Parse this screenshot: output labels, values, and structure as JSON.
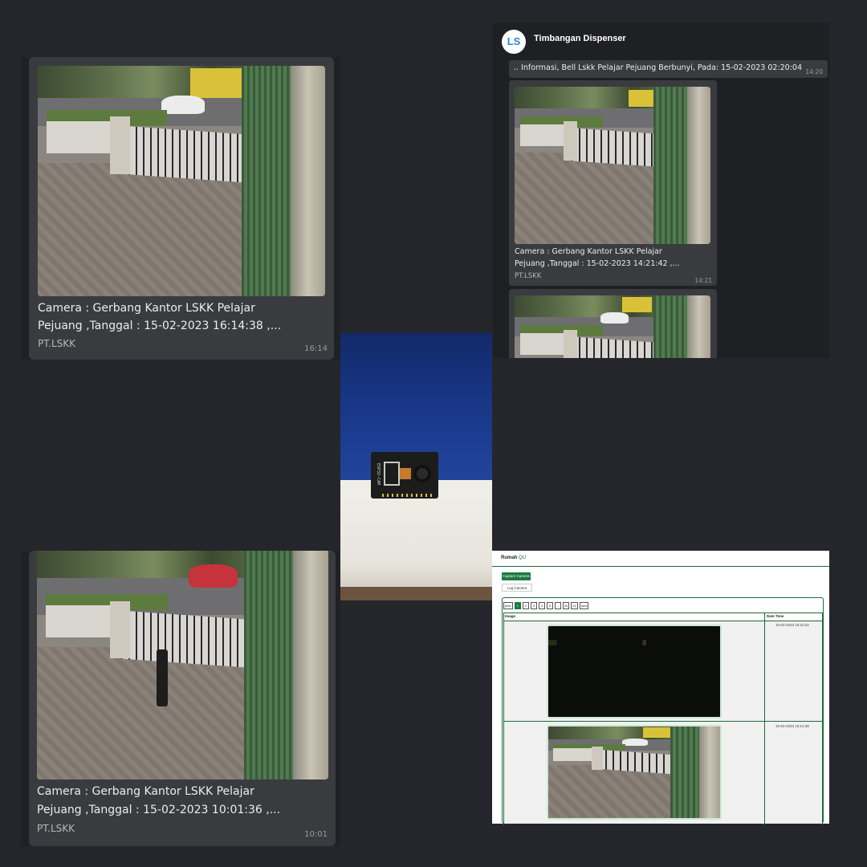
{
  "chat_top_left": {
    "caption_line1": "Camera : Gerbang Kantor LSKK Pelajar",
    "caption_line2": "Pejuang ,Tanggal : 15-02-2023 16:14:38  ,...",
    "sender": "PT.LSKK",
    "time": "16:14"
  },
  "chat_top_right": {
    "avatar_text": "LS",
    "title": "Timbangan Dispenser",
    "info_message": ".. Informasi, Bell Lskk Pelajar Pejuang Berbunyi, Pada: 15-02-2023 02:20:04",
    "info_time": "14:20",
    "caption_line1": "Camera : Gerbang Kantor LSKK Pelajar",
    "caption_line2": "Pejuang ,Tanggal : 15-02-2023 14:21:42  ,...",
    "sender": "PT.LSKK",
    "time": "14:21"
  },
  "chat_bottom_left": {
    "caption_line1": "Camera : Gerbang Kantor LSKK Pelajar",
    "caption_line2": "Pejuang ,Tanggal : 15-02-2023 10:01:36  ,...",
    "sender": "PT.LSKK",
    "time": "10:01"
  },
  "device": {
    "board_label": "ESP32-CAM"
  },
  "web": {
    "brand_main": "Rumah",
    "brand_sub": "QU",
    "capture_button": "Capture Camera",
    "log_tab": "Log Camera",
    "pager": [
      "prev",
      "1",
      "2",
      "3",
      "4",
      "5",
      "...",
      "20",
      "21",
      "next"
    ],
    "col_image": "Image",
    "col_datetime": "Date Time",
    "rows": [
      {
        "datetime": "15-02-2023 18:22:22"
      },
      {
        "datetime": "15-02-2023 16:14:38"
      }
    ]
  },
  "colors": {
    "background": "#25262b",
    "bubble": "#3a3b3e",
    "web_accent": "#1c7a3f"
  }
}
